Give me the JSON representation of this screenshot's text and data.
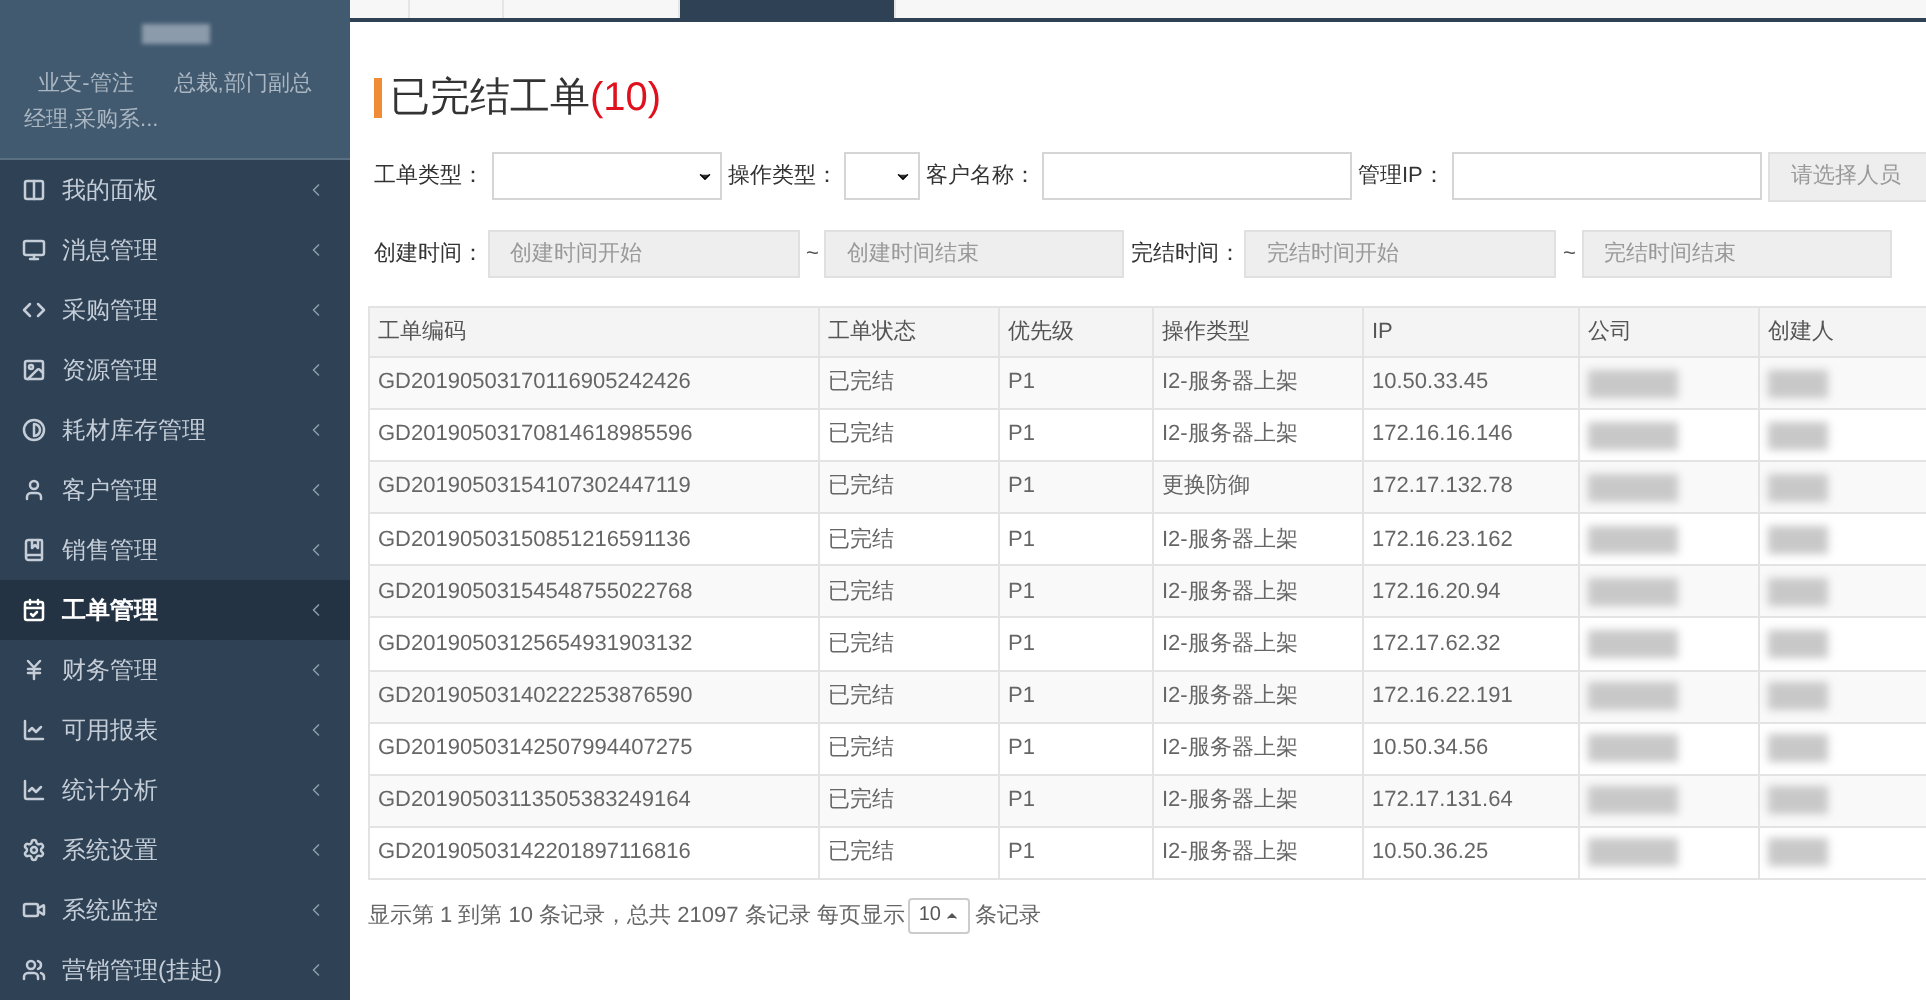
{
  "sidebar": {
    "profile": {
      "line_1": "业支-管注",
      "line_1_tail": "总裁,部门副总",
      "line_2": "经理,采购系..."
    },
    "items": [
      {
        "label": "我的面板",
        "selected": false
      },
      {
        "label": "消息管理",
        "selected": false
      },
      {
        "label": "采购管理",
        "selected": false
      },
      {
        "label": "资源管理",
        "selected": false
      },
      {
        "label": "耗材库存管理",
        "selected": false
      },
      {
        "label": "客户管理",
        "selected": false
      },
      {
        "label": "销售管理",
        "selected": false
      },
      {
        "label": "工单管理",
        "selected": true
      },
      {
        "label": "财务管理",
        "selected": false
      },
      {
        "label": "可用报表",
        "selected": false
      },
      {
        "label": "统计分析",
        "selected": false
      },
      {
        "label": "系统设置",
        "selected": false
      },
      {
        "label": "系统监控",
        "selected": false
      },
      {
        "label": "营销管理(挂起)",
        "selected": false
      }
    ]
  },
  "tabs": [
    {
      "selected": false
    },
    {
      "selected": false
    },
    {
      "selected": false
    },
    {
      "selected": true
    }
  ],
  "title": {
    "text": "已完结工单",
    "count": "(10)"
  },
  "filters": {
    "order_type": {
      "label": "工单类型："
    },
    "op_type": {
      "label": "操作类型："
    },
    "customer": {
      "label": "客户名称："
    },
    "ip": {
      "label": "管理IP："
    },
    "person": {
      "placeholder": "请选择人员"
    },
    "created": {
      "label": "创建时间：",
      "start": "创建时间开始",
      "sep": "~",
      "end": "创建时间结束"
    },
    "finished": {
      "label": "完结时间：",
      "start": "完结时间开始",
      "sep": "~",
      "end": "完结时间结束"
    }
  },
  "table": {
    "columns": [
      "工单编码",
      "工单状态",
      "优先级",
      "操作类型",
      "IP",
      "公司",
      "创建人"
    ],
    "rows": [
      {
        "code": "GD20190503170116905242426",
        "status": "已完结",
        "priority": "P1",
        "op": "I2-服务器上架",
        "ip": "10.50.33.45",
        "redacted": true
      },
      {
        "code": "GD20190503170814618985596",
        "status": "已完结",
        "priority": "P1",
        "op": "I2-服务器上架",
        "ip": "172.16.16.146",
        "redacted": true
      },
      {
        "code": "GD20190503154107302447119",
        "status": "已完结",
        "priority": "P1",
        "op": "更换防御",
        "ip": "172.17.132.78",
        "redacted": true
      },
      {
        "code": "GD20190503150851216591136",
        "status": "已完结",
        "priority": "P1",
        "op": "I2-服务器上架",
        "ip": "172.16.23.162",
        "redacted": true
      },
      {
        "code": "GD20190503154548755022768",
        "status": "已完结",
        "priority": "P1",
        "op": "I2-服务器上架",
        "ip": "172.16.20.94",
        "redacted": true
      },
      {
        "code": "GD20190503125654931903132",
        "status": "已完结",
        "priority": "P1",
        "op": "I2-服务器上架",
        "ip": "172.17.62.32",
        "redacted": true
      },
      {
        "code": "GD20190503140222253876590",
        "status": "已完结",
        "priority": "P1",
        "op": "I2-服务器上架",
        "ip": "172.16.22.191",
        "redacted": true
      },
      {
        "code": "GD20190503142507994407275",
        "status": "已完结",
        "priority": "P1",
        "op": "I2-服务器上架",
        "ip": "10.50.34.56",
        "redacted": true
      },
      {
        "code": "GD20190503113505383249164",
        "status": "已完结",
        "priority": "P1",
        "op": "I2-服务器上架",
        "ip": "172.17.131.64",
        "redacted": true
      },
      {
        "code": "GD20190503142201897116816",
        "status": "已完结",
        "priority": "P1",
        "op": "I2-服务器上架",
        "ip": "10.50.36.25",
        "redacted": true
      }
    ]
  },
  "pagination": {
    "summary": "显示第 1 到第 10 条记录，总共 21097 条记录 每页显示",
    "page_size": "10",
    "suffix": "条记录"
  }
}
